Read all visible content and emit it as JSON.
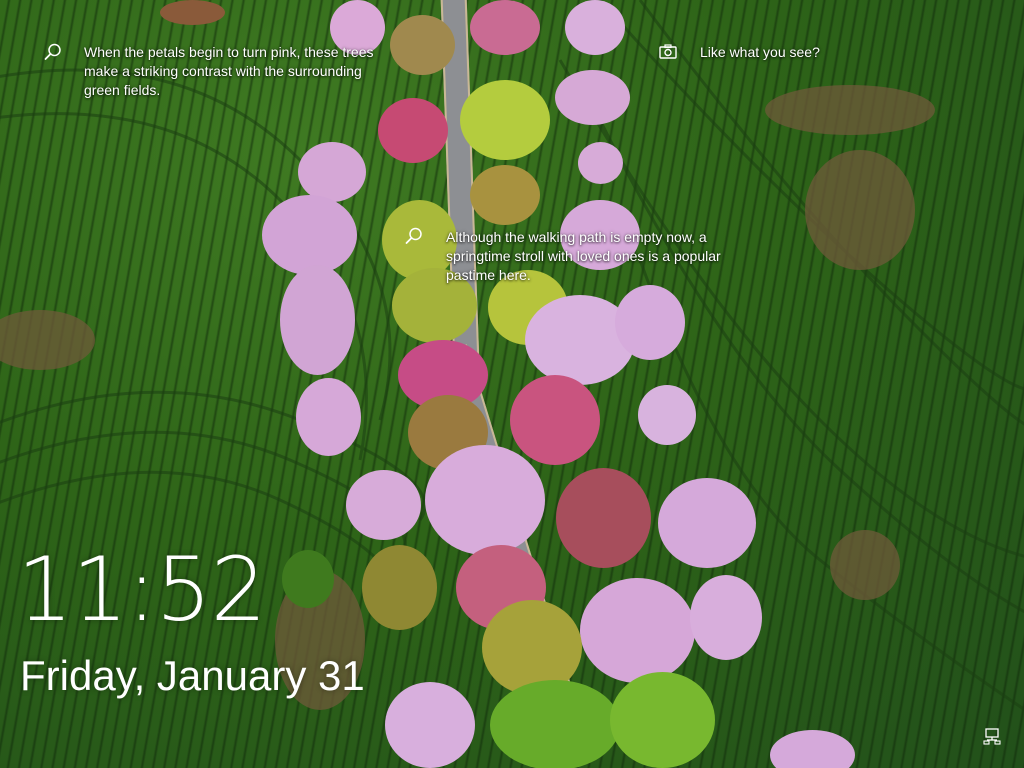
{
  "lockscreen": {
    "time": "11:52",
    "date": "Friday, January 31",
    "hints": [
      {
        "icon": "search-icon",
        "text": "When the petals begin to turn pink, these trees make a striking contrast with the surrounding green fields."
      },
      {
        "icon": "camera-icon",
        "text": "Like what you see?"
      },
      {
        "icon": "search-icon",
        "text": "Although the walking path is empty now, a springtime stroll with loved ones is a popular pastime here."
      }
    ],
    "status_icons": [
      {
        "icon": "network-icon"
      }
    ]
  },
  "colors": {
    "field_green": "#2f5a1e",
    "path_gray": "#8d8f93",
    "blossom_pink": "#d9a7d6",
    "blossom_magenta": "#c9507c",
    "tree_yellow_green": "#a9bd3a",
    "text": "#ffffff"
  }
}
